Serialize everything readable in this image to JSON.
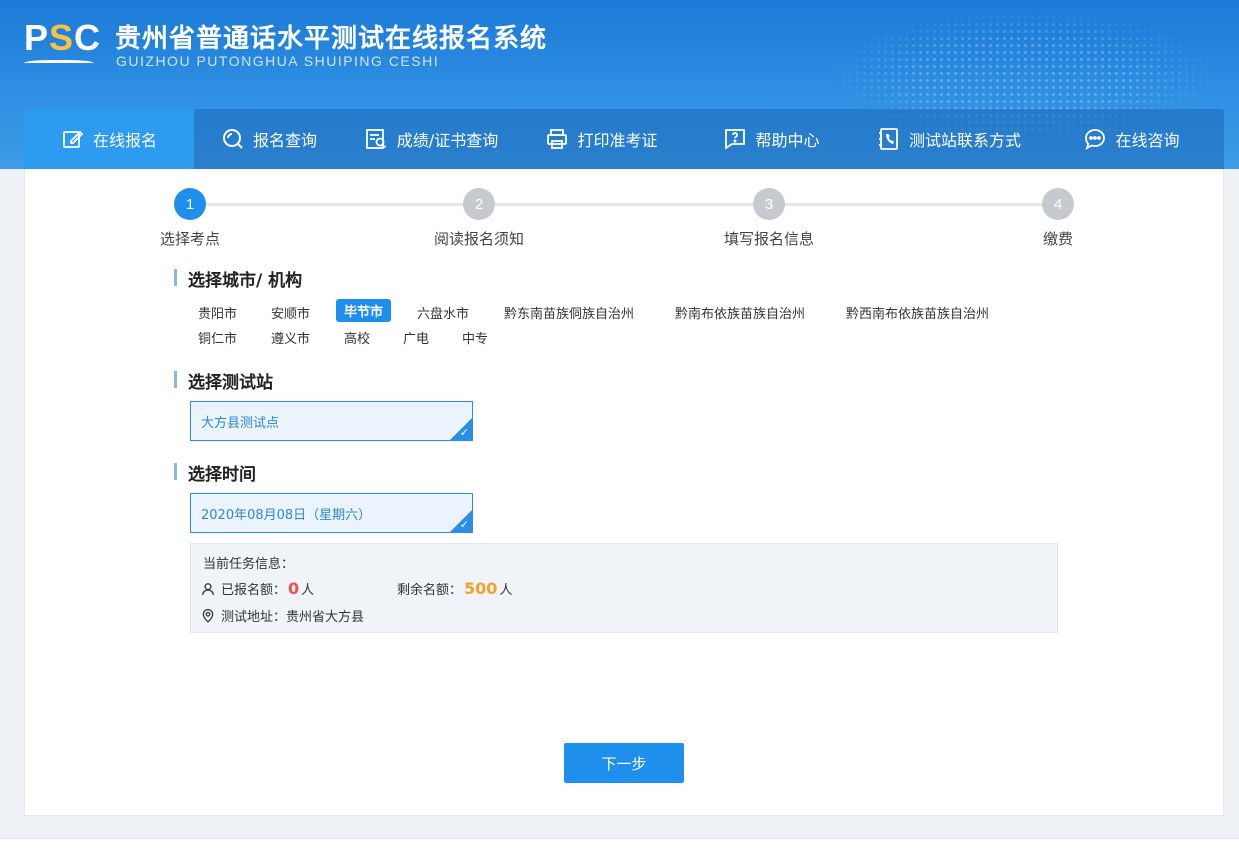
{
  "header": {
    "logo": {
      "p": "P",
      "s": "S",
      "c": "C"
    },
    "title": "贵州省普通话水平测试在线报名系统",
    "subtitle": "GUIZHOU PUTONGHUA SHUIPING CESHI"
  },
  "nav": [
    {
      "label": "在线报名",
      "icon": "edit-icon",
      "active": true
    },
    {
      "label": "报名查询",
      "icon": "search-icon"
    },
    {
      "label": "成绩/证书查询",
      "icon": "document-search-icon"
    },
    {
      "label": "打印准考证",
      "icon": "printer-icon"
    },
    {
      "label": "帮助中心",
      "icon": "help-icon"
    },
    {
      "label": "测试站联系方式",
      "icon": "phone-icon"
    },
    {
      "label": "在线咨询",
      "icon": "chat-icon"
    }
  ],
  "steps": [
    {
      "num": "1",
      "label": "选择考点",
      "active": true
    },
    {
      "num": "2",
      "label": "阅读报名须知"
    },
    {
      "num": "3",
      "label": "填写报名信息"
    },
    {
      "num": "4",
      "label": "缴费"
    }
  ],
  "sections": {
    "city_title": "选择城市/ 机构",
    "station_title": "选择测试站",
    "time_title": "选择时间"
  },
  "cities": [
    "贵阳市",
    "安顺市",
    "毕节市",
    "六盘水市",
    "黔东南苗族侗族自治州",
    "黔南布依族苗族自治州",
    "黔西南布依族苗族自治州",
    "铜仁市",
    "遵义市",
    "高校",
    "广电",
    "中专"
  ],
  "selected_city": "毕节市",
  "station": {
    "value": "大方县测试点"
  },
  "time": {
    "value": "2020年08月08日（星期六）"
  },
  "task_info": {
    "title": "当前任务信息：",
    "registered_label": "已报名额：",
    "registered_count": "0",
    "remaining_label": "剩余名额：",
    "remaining_count": "500",
    "unit": "人",
    "address_label": "测试地址：",
    "address": "贵州省大方县"
  },
  "next_button": "下一步",
  "colors": {
    "accent": "#1f8fed",
    "header": "#1a7ad6",
    "red": "#f0504c",
    "orange": "#f5a02a"
  }
}
